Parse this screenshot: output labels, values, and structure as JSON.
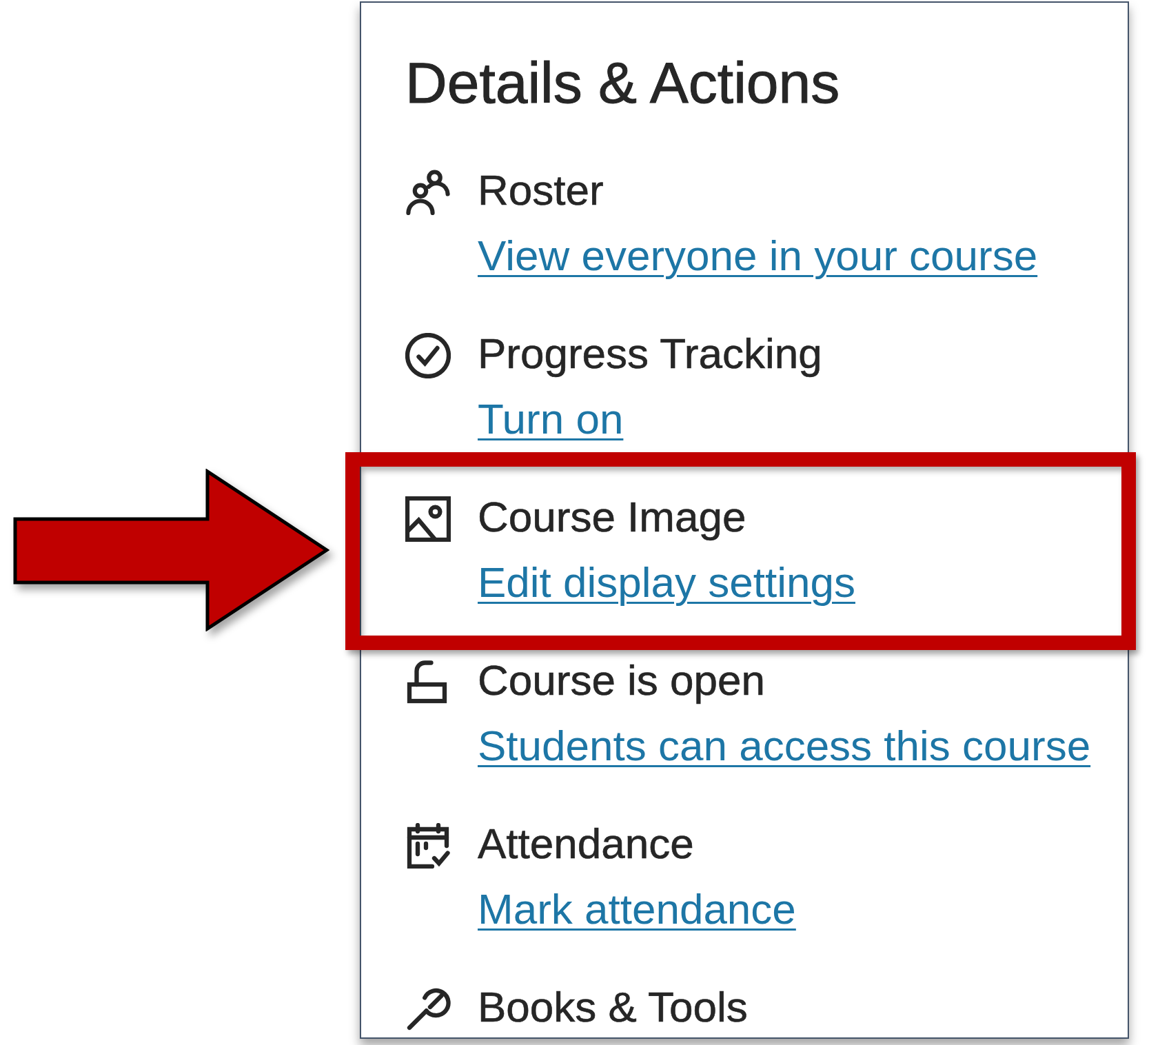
{
  "panel": {
    "title": "Details & Actions",
    "items": [
      {
        "kind": "roster",
        "label": "Roster",
        "link": "View everyone in your course",
        "highlighted": false
      },
      {
        "kind": "progress",
        "label": "Progress Tracking",
        "link": "Turn on",
        "highlighted": false
      },
      {
        "kind": "image",
        "label": "Course Image",
        "link": "Edit display settings",
        "highlighted": true
      },
      {
        "kind": "access",
        "label": "Course is open",
        "link": "Students can access this course",
        "highlighted": false
      },
      {
        "kind": "attendance",
        "label": "Attendance",
        "link": "Mark attendance",
        "highlighted": false
      },
      {
        "kind": "tools",
        "label": "Books & Tools",
        "highlighted": false
      }
    ]
  }
}
